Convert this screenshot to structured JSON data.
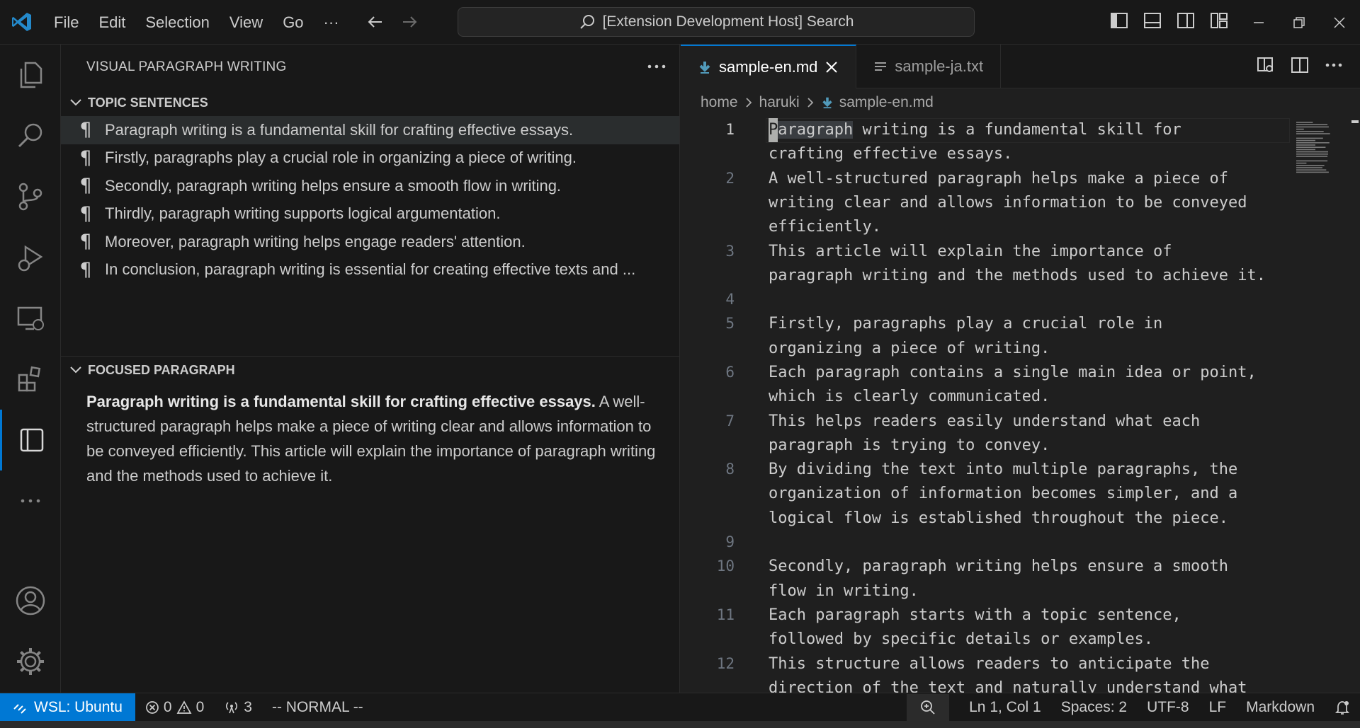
{
  "titlebar": {
    "menu": [
      "File",
      "Edit",
      "Selection",
      "View",
      "Go",
      "···"
    ],
    "search": "[Extension Development Host] Search"
  },
  "sidebar": {
    "title": "VISUAL PARAGRAPH WRITING",
    "topic_sentences": {
      "title": "TOPIC SENTENCES",
      "items": [
        "Paragraph writing is a fundamental skill for crafting effective essays.",
        "Firstly, paragraphs play a crucial role in organizing a piece of writing.",
        "Secondly, paragraph writing helps ensure a smooth flow in writing.",
        "Thirdly, paragraph writing supports logical argumentation.",
        "Moreover, paragraph writing helps engage readers' attention.",
        "In conclusion, paragraph writing is essential for creating effective texts and ..."
      ]
    },
    "focused_paragraph": {
      "title": "FOCUSED PARAGRAPH",
      "bold_text": "Paragraph writing is a fundamental skill for crafting effective essays.",
      "rest_text": " A well-structured paragraph helps make a piece of writing clear and allows information to be conveyed efficiently. This article will explain the importance of paragraph writing and the methods used to achieve it."
    }
  },
  "editor": {
    "tabs": [
      {
        "label": "sample-en.md",
        "active": true
      },
      {
        "label": "sample-ja.txt",
        "active": false
      }
    ],
    "breadcrumb": [
      "home",
      "haruki",
      "sample-en.md"
    ],
    "first_word_cursor": "P",
    "first_word_rest": "aragraph",
    "first_line_rest": " writing is a fundamental skill for",
    "lines": [
      {
        "n": "1",
        "rows": [
          "",
          "crafting effective essays."
        ]
      },
      {
        "n": "2",
        "rows": [
          "A well-structured paragraph helps make a piece of",
          "writing clear and allows information to be conveyed",
          "efficiently."
        ]
      },
      {
        "n": "3",
        "rows": [
          "This article will explain the importance of",
          "paragraph writing and the methods used to achieve it."
        ]
      },
      {
        "n": "4",
        "rows": [
          ""
        ]
      },
      {
        "n": "5",
        "rows": [
          "Firstly, paragraphs play a crucial role in",
          "organizing a piece of writing."
        ]
      },
      {
        "n": "6",
        "rows": [
          "Each paragraph contains a single main idea or point,",
          "which is clearly communicated."
        ]
      },
      {
        "n": "7",
        "rows": [
          "This helps readers easily understand what each",
          "paragraph is trying to convey."
        ]
      },
      {
        "n": "8",
        "rows": [
          "By dividing the text into multiple paragraphs, the",
          "organization of information becomes simpler, and a",
          "logical flow is established throughout the piece."
        ]
      },
      {
        "n": "9",
        "rows": [
          ""
        ]
      },
      {
        "n": "10",
        "rows": [
          "Secondly, paragraph writing helps ensure a smooth",
          "flow in writing."
        ]
      },
      {
        "n": "11",
        "rows": [
          "Each paragraph starts with a topic sentence,",
          "followed by specific details or examples."
        ]
      },
      {
        "n": "12",
        "rows": [
          "This structure allows readers to anticipate the",
          "direction of the text and naturally understand what"
        ]
      }
    ]
  },
  "statusbar": {
    "remote": "WSL: Ubuntu",
    "errors": "0",
    "warnings": "0",
    "ports": "3",
    "vim_mode": "-- NORMAL --",
    "cursor_pos": "Ln 1, Col 1",
    "spaces": "Spaces: 2",
    "encoding": "UTF-8",
    "eol": "LF",
    "language": "Markdown"
  },
  "colors": {
    "accent": "#0078d4",
    "markdown_icon": "#519aba"
  }
}
